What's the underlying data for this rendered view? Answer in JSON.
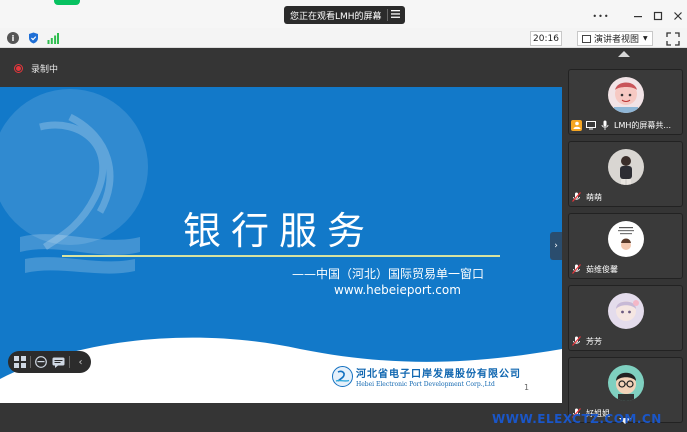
{
  "titlebar": {
    "share_banner": "您正在观看LMH的屏幕",
    "menu_icon": "hamburger-icon",
    "controls": [
      "more-icon",
      "minimize-icon",
      "maximize-icon",
      "close-icon"
    ]
  },
  "toolbar": {
    "icons": [
      "info-icon",
      "shield-icon",
      "signal-icon"
    ],
    "time": "20:16",
    "view_button": "演讲者视图",
    "fullscreen_icon": "fullscreen-icon"
  },
  "stage": {
    "recording_label": "录制中"
  },
  "slide": {
    "title": "银行服务",
    "subtitle": "——中国（河北）国际贸易单一窗口",
    "url": "www.hebeieport.com",
    "company_cn": "河北省电子口岸发展股份有限公司",
    "company_en": "Hebei Electronic Port Development Corp.,Ltd",
    "page_number": "1",
    "accent_color": "#1279c9"
  },
  "slide_toolbar": {
    "buttons": [
      "grid-icon",
      "emoji-icon",
      "chat-icon",
      "back-icon"
    ]
  },
  "participants": [
    {
      "name": "LMH的屏幕共...",
      "role": "host",
      "avatar": "cartoon-avatar"
    },
    {
      "name": "萌萌",
      "role": "attendee",
      "avatar": "photo-avatar"
    },
    {
      "name": "茹维俊馨",
      "role": "attendee",
      "avatar": "poster-avatar"
    },
    {
      "name": "芳芳",
      "role": "attendee",
      "avatar": "doll-avatar"
    },
    {
      "name": "好姐姐",
      "role": "attendee",
      "avatar": "cartoon-glasses-avatar"
    }
  ],
  "watermark": "WWW.ELEXCTZ.COM.CN"
}
